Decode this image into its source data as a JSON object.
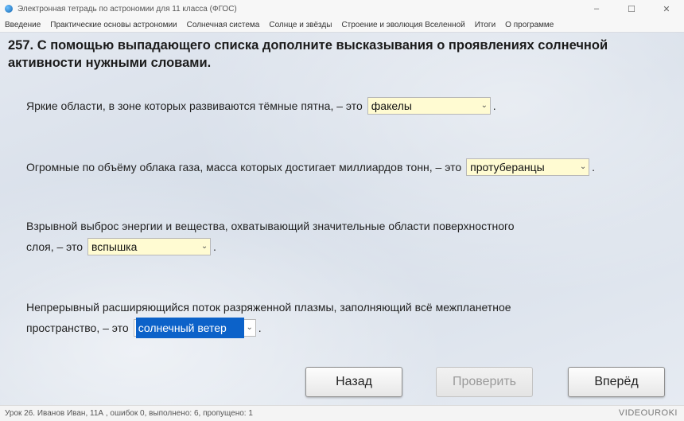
{
  "window": {
    "title": "Электронная тетрадь по астрономии для 11 класса (ФГОС)",
    "controls": {
      "minimize": "–",
      "maximize": "☐",
      "close": "✕"
    }
  },
  "menu": [
    "Введение",
    "Практические основы астрономии",
    "Солнечная система",
    "Солнце и звёзды",
    "Строение и эволюция Вселенной",
    "Итоги",
    "О программе"
  ],
  "task": {
    "title": "257. С помощью выпадающего списка дополните высказывания о проявлениях солнечной активности нужными словами."
  },
  "statements": [
    {
      "text": "Яркие области, в зоне которых развиваются тёмные пятна, – это",
      "answer": "факелы",
      "end": "."
    },
    {
      "text": "Огромные по объёму облака газа, масса которых достигает миллиардов тонн, – это",
      "answer": "протуберанцы",
      "end": "."
    },
    {
      "line1": "Взрывной выброс энергии и вещества, охватывающий значительные области поверхностного",
      "line2": "слоя, – это",
      "answer": "вспышка",
      "end": "."
    },
    {
      "line1": "Непрерывный расширяющийся поток разряженной плазмы, заполняющий всё межпланетное",
      "line2": "пространство, – это",
      "answer": "солнечный ветер",
      "end": "."
    }
  ],
  "buttons": {
    "back": "Назад",
    "check": "Проверить",
    "forward": "Вперёд"
  },
  "status": {
    "text": "Урок 26. Иванов Иван, 11А , ошибок 0, выполнено: 6, пропущено: 1",
    "watermark": "VIDEOUROKI"
  },
  "colors": {
    "select_bg": "#fffbd2",
    "selected_highlight": "#0c62c9"
  }
}
